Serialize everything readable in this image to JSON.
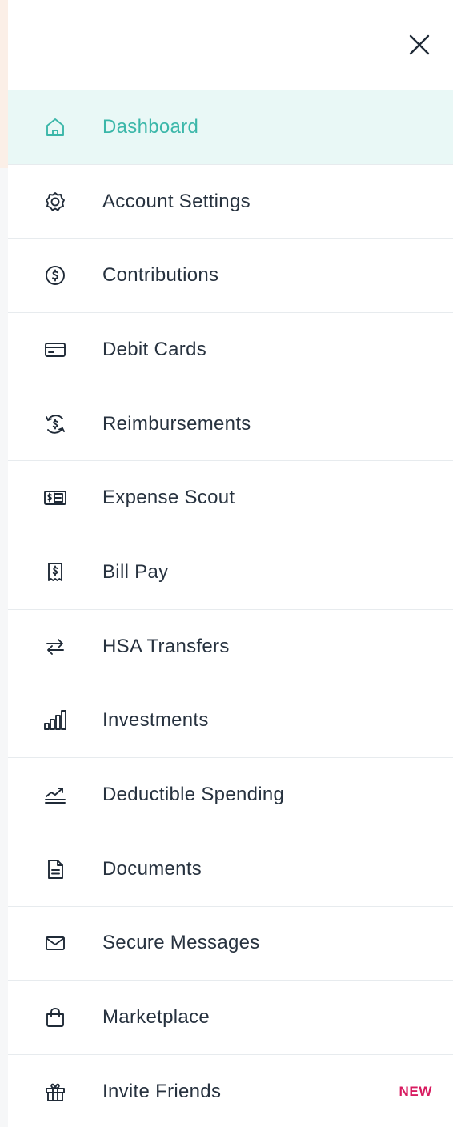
{
  "header": {
    "close_icon": "close-icon"
  },
  "accent_color": "#3bb7a9",
  "menu": {
    "items": [
      {
        "label": "Dashboard",
        "icon": "home-icon",
        "active": true
      },
      {
        "label": "Account Settings",
        "icon": "gear-icon"
      },
      {
        "label": "Contributions",
        "icon": "dollar-circle-icon"
      },
      {
        "label": "Debit Cards",
        "icon": "credit-card-icon"
      },
      {
        "label": "Reimbursements",
        "icon": "dollar-refresh-icon"
      },
      {
        "label": "Expense Scout",
        "icon": "receipt-scan-icon"
      },
      {
        "label": "Bill Pay",
        "icon": "bill-icon"
      },
      {
        "label": "HSA Transfers",
        "icon": "transfer-arrows-icon"
      },
      {
        "label": "Investments",
        "icon": "bar-chart-icon"
      },
      {
        "label": "Deductible Spending",
        "icon": "trend-chart-icon"
      },
      {
        "label": "Documents",
        "icon": "document-icon"
      },
      {
        "label": "Secure Messages",
        "icon": "envelope-icon"
      },
      {
        "label": "Marketplace",
        "icon": "shopping-bag-icon"
      },
      {
        "label": "Invite Friends",
        "icon": "gift-icon",
        "badge": "NEW",
        "badge_color": "#d81b60"
      }
    ]
  }
}
